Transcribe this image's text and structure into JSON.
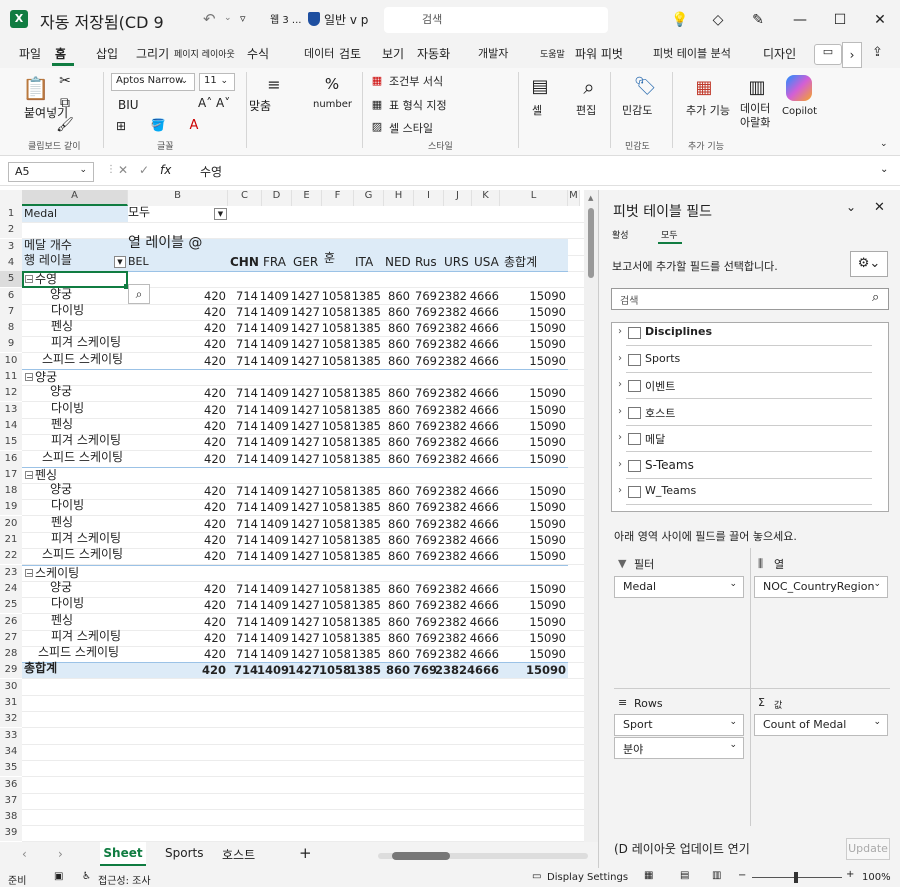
{
  "titlebar": {
    "autosave": "자동 저장됨(CD 9",
    "doc": "웹 3 ...",
    "label": "일반 v p",
    "search_placeholder": "검색"
  },
  "menu": [
    "파일",
    "홈",
    "삽입",
    "그리기",
    "페이지 레이아웃",
    "수식",
    "데이터",
    "검토",
    "보기",
    "자동화",
    "개발자",
    "도움말",
    "파워 피벗",
    "피벗 테이블 분석",
    "디자인"
  ],
  "ribbon": {
    "paste": "붙여넣기",
    "clipboard": "클립보드 같이",
    "font_name": "Aptos Narrow",
    "font_size": "11",
    "biu": "BIU",
    "font_group": "글꼴",
    "align": "맞춤",
    "number": "number",
    "cond_format": "조건부 서식",
    "table_format": "표 형식 지정",
    "cell_style": "셀 스타일",
    "style_group": "스타일",
    "cells": "셀",
    "edit": "편집",
    "sensitivity": "민감도",
    "sensitivity_group": "민감도",
    "addins": "추가 기능",
    "addins_group": "추가 기능",
    "analyze": "데이터 아랄화",
    "copilot": "Copilot"
  },
  "formula": {
    "namebox": "A5",
    "fx": "fx",
    "value": "수영"
  },
  "columns": [
    "A",
    "B",
    "C",
    "D",
    "E",
    "F",
    "G",
    "H",
    "I",
    "J",
    "K",
    "L",
    "M"
  ],
  "sheet": {
    "filter_label": "Medal",
    "filter_value": "모두",
    "count_label": "메달 개수",
    "col_labels": "열 레이블 @",
    "row_labels": "행 레이블",
    "headers": [
      "BEL",
      "CHN",
      "FRA",
      "GER",
      "훈",
      "ITA",
      "NED",
      "Rus",
      "URS",
      "USA",
      "총합계"
    ],
    "groups": [
      {
        "name": "수영",
        "items": [
          "양궁",
          "다이빙",
          "펜싱",
          "피겨 스케이팅",
          "스피드 스케이팅"
        ]
      },
      {
        "name": "양궁",
        "items": [
          "양궁",
          "다이빙",
          "펜싱",
          "피겨 스케이팅",
          "스피드 스케이팅"
        ]
      },
      {
        "name": "펜싱",
        "items": [
          "양궁",
          "다이빙",
          "펜싱",
          "피겨 스케이팅",
          "스피드 스케이팅"
        ]
      },
      {
        "name": "스케이팅",
        "items": [
          "양궁",
          "다이빙",
          "펜싱",
          "피겨 스케이팅",
          "스피드 스케이팅"
        ]
      }
    ],
    "values": [
      "420",
      "714",
      "1409",
      "1427",
      "1058",
      "1385",
      "860",
      "769",
      "2382",
      "4666",
      "15090"
    ],
    "total_label": "총합계",
    "rows_after": [
      "30",
      "31",
      "32",
      "33",
      "34",
      "35",
      "36",
      "37",
      "38",
      "39"
    ]
  },
  "tabs": [
    "Sheet",
    "Sports",
    "호스트"
  ],
  "status": {
    "ready": "준비",
    "accessibility": "접근성: 조사",
    "display": "Display Settings",
    "zoom": "100%"
  },
  "panel": {
    "title": "피벗 테이블 필드",
    "tab_active": "활성",
    "tab_all": "모두",
    "instruction": "보고서에 추가할 필드를 선택합니다.",
    "search": "검색",
    "fields": [
      "Disciplines",
      "Sports",
      "이벤트",
      "호스트",
      "메달",
      "S-Teams",
      "W_Teams"
    ],
    "drag_note": "아래 영역 사이에 필드를 끌어 놓으세요.",
    "filter_title": "필터",
    "filter_item": "Medal",
    "columns_title": "열",
    "columns_item": "NOC_CountryRegion",
    "rows_title": "Rows",
    "rows_items": [
      "Sport",
      "분야"
    ],
    "values_title": "값",
    "values_item": "Count of Medal",
    "defer": "(D 레이아웃 업데이트 연기",
    "update": "Update"
  },
  "colors": {
    "accent": "#107c41",
    "pivot_header": "#ddebf7",
    "green": "#217346"
  }
}
